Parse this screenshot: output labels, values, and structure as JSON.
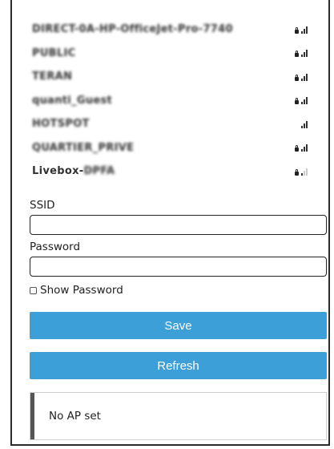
{
  "networks": [
    {
      "ssid": "DIRECT-0A-HP-OfficeJet-Pro-7740",
      "locked": true,
      "bars": 2
    },
    {
      "ssid": "PUBLIC",
      "locked": true,
      "bars": 2
    },
    {
      "ssid": "TERAN",
      "locked": true,
      "bars": 2
    },
    {
      "ssid": "quanti_Guest",
      "locked": true,
      "bars": 2
    },
    {
      "ssid": "HOTSPOT",
      "locked": false,
      "bars": 2
    },
    {
      "ssid": "QUARTIER_PRIVE",
      "locked": true,
      "bars": 2
    },
    {
      "ssid_visible": "Livebox-",
      "ssid_obscured": "DPFA",
      "locked": true,
      "bars": 1
    }
  ],
  "form": {
    "ssid_label": "SSID",
    "ssid_value": "",
    "password_label": "Password",
    "password_value": "",
    "show_password_label": "Show Password",
    "save_label": "Save",
    "refresh_label": "Refresh"
  },
  "status": {
    "text": "No AP set"
  },
  "colors": {
    "button": "#3d9fd8",
    "accent": "#555555"
  }
}
